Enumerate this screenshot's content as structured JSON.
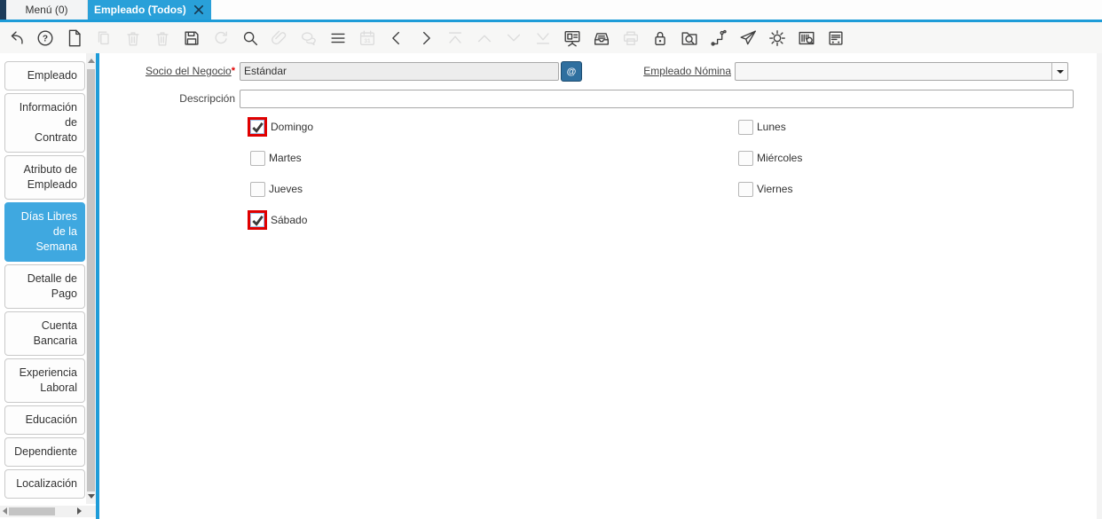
{
  "tabbar": {
    "menu_tab_label": "Menú (0)",
    "active_tab_label": "Empleado (Todos)"
  },
  "toolbar": {
    "icons": [
      {
        "name": "undo",
        "enabled": true
      },
      {
        "name": "help",
        "enabled": true
      },
      {
        "name": "new-record",
        "enabled": true
      },
      {
        "name": "copy-record",
        "enabled": false
      },
      {
        "name": "delete-record",
        "enabled": false
      },
      {
        "name": "delete-selection",
        "enabled": false
      },
      {
        "name": "save",
        "enabled": true
      },
      {
        "name": "refresh",
        "enabled": false
      },
      {
        "name": "find",
        "enabled": true
      },
      {
        "name": "attachment",
        "enabled": false
      },
      {
        "name": "chat",
        "enabled": false
      },
      {
        "name": "grid-toggle",
        "enabled": true
      },
      {
        "name": "calendar",
        "enabled": false
      },
      {
        "name": "previous-record",
        "enabled": true
      },
      {
        "name": "next-record",
        "enabled": true
      },
      {
        "name": "first-record",
        "enabled": false
      },
      {
        "name": "parent-record",
        "enabled": false
      },
      {
        "name": "detail-record",
        "enabled": false
      },
      {
        "name": "last-record",
        "enabled": false
      },
      {
        "name": "report",
        "enabled": true
      },
      {
        "name": "archive",
        "enabled": true
      },
      {
        "name": "print",
        "enabled": false
      },
      {
        "name": "lock",
        "enabled": true
      },
      {
        "name": "zoom-across",
        "enabled": true
      },
      {
        "name": "workflow",
        "enabled": true
      },
      {
        "name": "send-mail",
        "enabled": true
      },
      {
        "name": "preferences",
        "enabled": true
      },
      {
        "name": "barcode-lookup",
        "enabled": true
      },
      {
        "name": "quick-form",
        "enabled": true
      }
    ]
  },
  "sidebar": {
    "items": [
      {
        "label": "Empleado",
        "selected": false
      },
      {
        "label": "Información de Contrato",
        "selected": false
      },
      {
        "label": "Atributo de Empleado",
        "selected": false
      },
      {
        "label": "Días Libres de la Semana",
        "selected": true
      },
      {
        "label": "Detalle de Pago",
        "selected": false
      },
      {
        "label": "Cuenta Bancaria",
        "selected": false
      },
      {
        "label": "Experiencia Laboral",
        "selected": false
      },
      {
        "label": "Educación",
        "selected": false
      },
      {
        "label": "Dependiente",
        "selected": false
      },
      {
        "label": "Localización",
        "selected": false
      }
    ]
  },
  "form": {
    "socio_del_negocio": {
      "label": "Socio del Negocio",
      "required_marker": "*",
      "value": "Estándar"
    },
    "empleado_nomina": {
      "label": "Empleado Nómina",
      "value": ""
    },
    "descripcion": {
      "label": "Descripción",
      "value": ""
    },
    "checkboxes": [
      {
        "label": "Domingo",
        "checked": true
      },
      {
        "label": "Lunes",
        "checked": false
      },
      {
        "label": "Martes",
        "checked": false
      },
      {
        "label": "Miércoles",
        "checked": false
      },
      {
        "label": "Jueves",
        "checked": false
      },
      {
        "label": "Viernes",
        "checked": false
      },
      {
        "label": "Sábado",
        "checked": true
      }
    ]
  },
  "colors": {
    "active_tab_blue": "#29a0d9",
    "selected_sidebar_blue": "#3fa8e0",
    "divider_blue": "#1e9cd8",
    "navy": "#1d3c5a",
    "checked_checkbox_border": "#e00000",
    "record_button_blue": "#2f6f9f"
  }
}
